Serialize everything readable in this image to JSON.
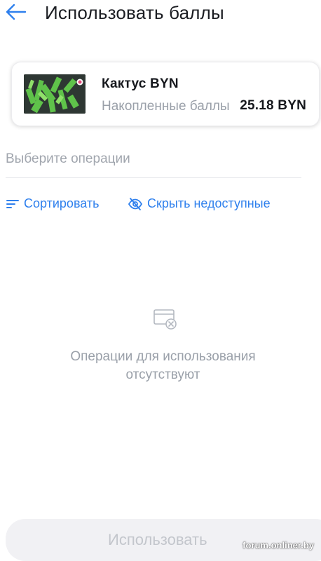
{
  "header": {
    "title": "Использовать баллы"
  },
  "card": {
    "name": "Кактус BYN",
    "subtitle": "Накопленные баллы",
    "amount": "25.18 BYN"
  },
  "operations": {
    "placeholder": "Выберите операции"
  },
  "controls": {
    "sort_label": "Сортировать",
    "hide_label": "Скрыть недоступные"
  },
  "empty_state": {
    "line1": "Операции для использования",
    "line2": "отсутствуют"
  },
  "footer": {
    "use_label": "Использовать"
  },
  "watermark": "forum.onliner.by",
  "colors": {
    "accent": "#2f80ed",
    "text_primary": "#16181d",
    "text_muted": "#9aa0a9",
    "button_disabled_bg": "#f1f1f4"
  }
}
